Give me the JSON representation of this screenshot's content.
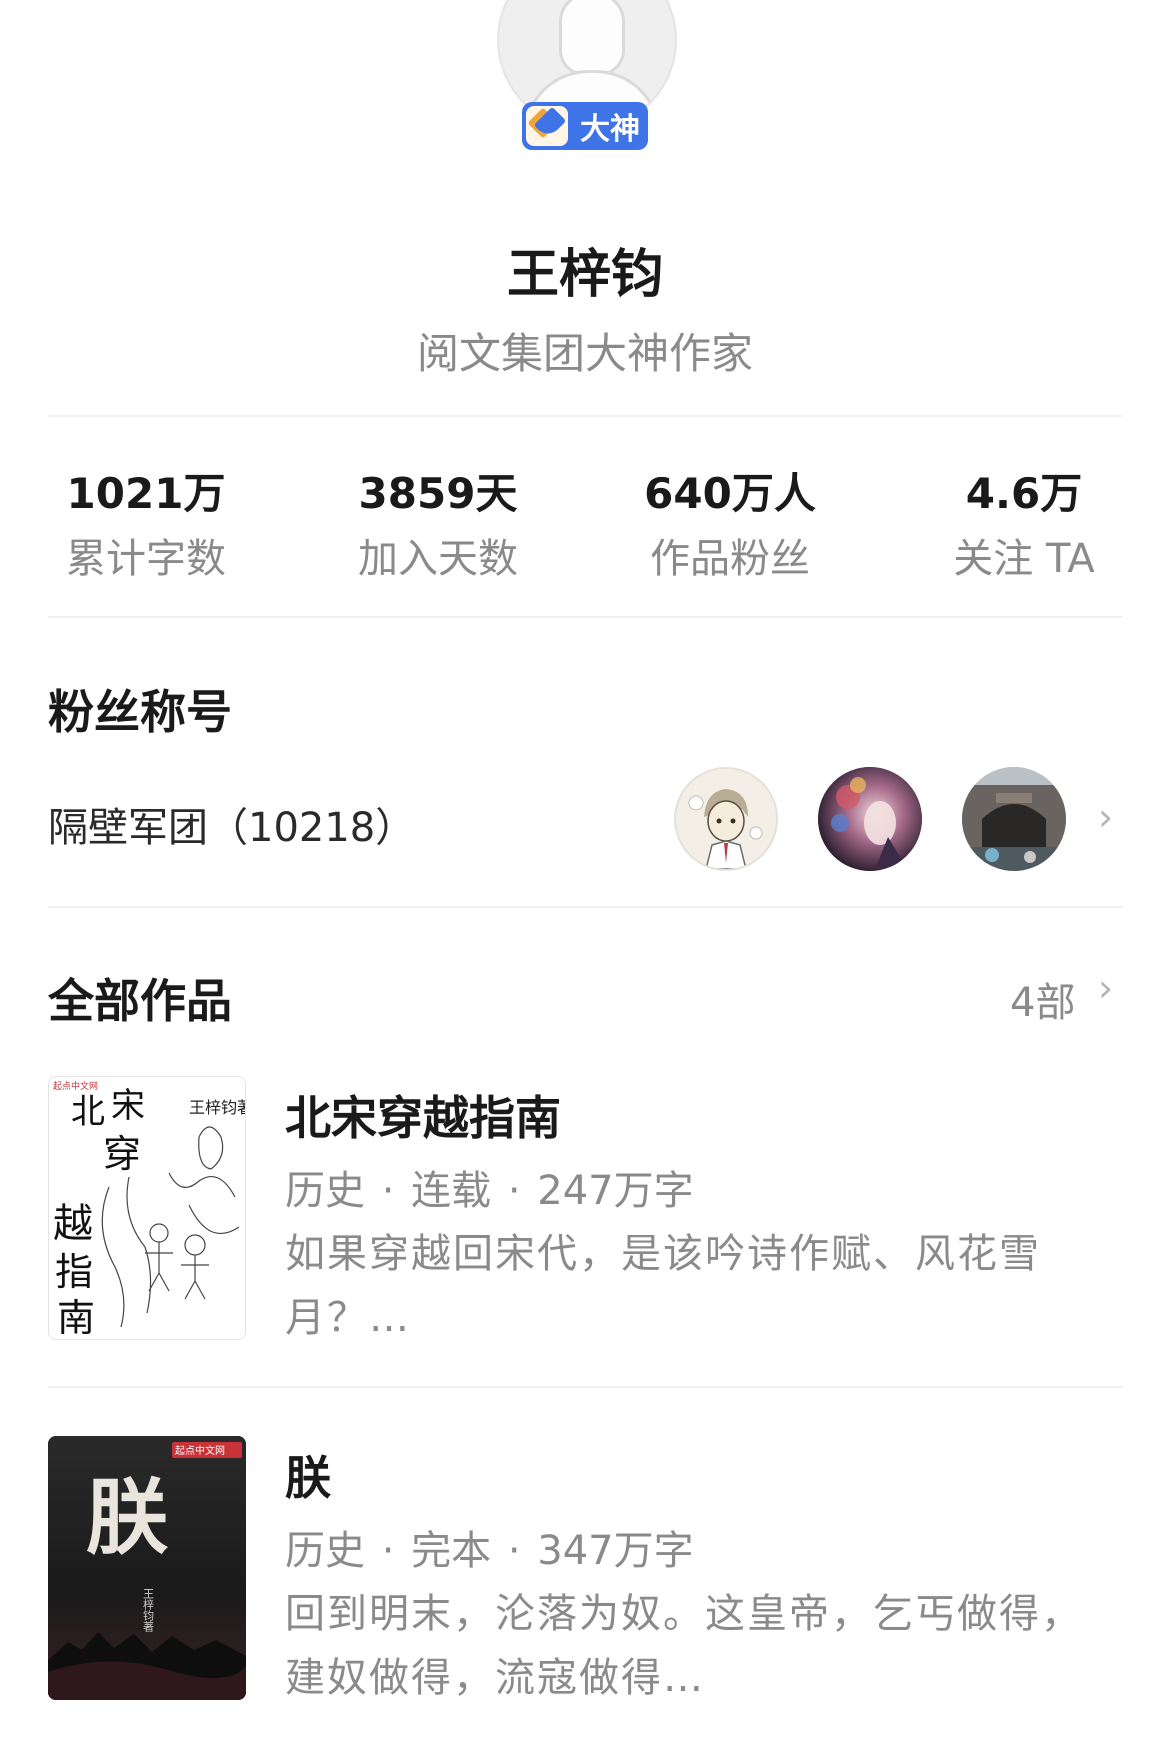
{
  "profile": {
    "badge_label": "大神",
    "name": "王梓钧",
    "subtitle": "阅文集团大神作家"
  },
  "stats": [
    {
      "value": "1021万",
      "label": "累计字数"
    },
    {
      "value": "3859天",
      "label": "加入天数"
    },
    {
      "value": "640万人",
      "label": "作品粉丝"
    },
    {
      "value": "4.6万",
      "label": "关注 TA"
    }
  ],
  "fans": {
    "title": "粉丝称号",
    "group_name": "隔壁军团（10218）"
  },
  "works": {
    "title": "全部作品",
    "count": "4部",
    "books": [
      {
        "cover_publisher": "起点中文网",
        "cover_title_chars": [
          "北",
          "宋",
          "穿",
          "越",
          "指",
          "南"
        ],
        "cover_author": "王梓钧著",
        "title": "北宋穿越指南",
        "meta": "历史 · 连载 · 247万字",
        "desc": "如果穿越回宋代，是该吟诗作赋、风花雪月？…"
      },
      {
        "cover_publisher": "起点中文网",
        "cover_title": "朕",
        "cover_author": "王梓钧著",
        "title": "朕",
        "meta": "历史 · 完本 · 347万字",
        "desc": "回到明末，沦落为奴。这皇帝，乞丐做得，建奴做得，流寇做得…"
      }
    ]
  },
  "icons": {
    "chevron": "chevron-right-icon",
    "badge": "pen-nib-icon"
  },
  "colors": {
    "badge_bg": "#3f73e8",
    "muted_text": "#8a8a8a",
    "primary_text": "#1a1a1a"
  }
}
